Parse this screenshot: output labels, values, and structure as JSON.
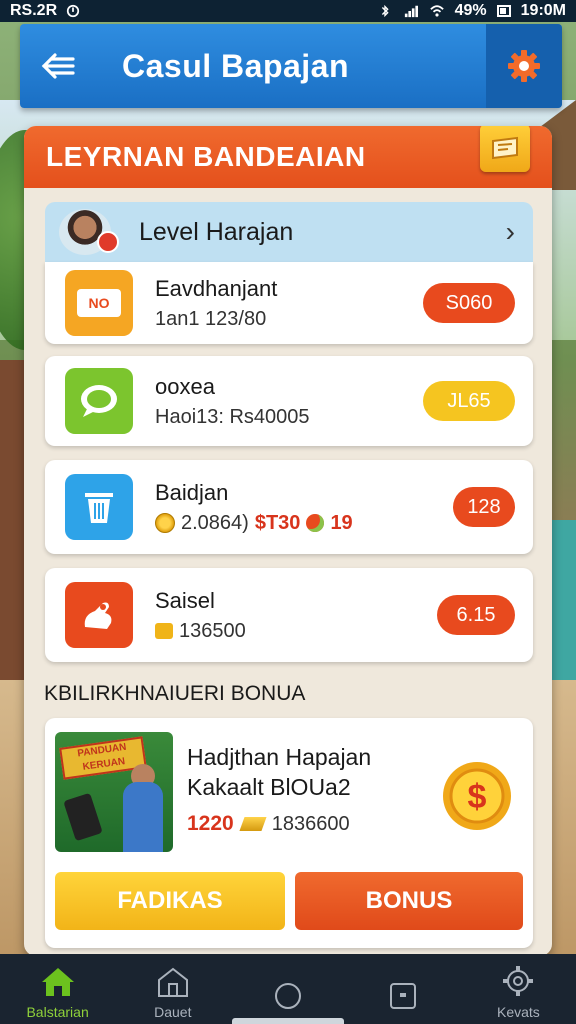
{
  "status_bar": {
    "left_text": "RS.2R",
    "battery": "49%",
    "time": "19:0M"
  },
  "header": {
    "title": "Casul Bapajan",
    "back_icon": "back-arrow-icon",
    "settings_icon": "gear-icon"
  },
  "panel": {
    "banner_title": "LEYRNAN BANDEAIAN"
  },
  "level": {
    "label": "Level Harajan"
  },
  "rewards": [
    {
      "title": "Eavdhanjant",
      "sub": "1an1 123/80",
      "pill": "S060",
      "icon": "ticket-icon",
      "icon_label": "NO",
      "icon_color": "#f5a623",
      "pill_color": "#e84a1e"
    },
    {
      "title": "ooxea",
      "sub": "Haoi13: Rs40005",
      "pill": "JL65",
      "icon": "chat-icon",
      "icon_color": "#7cc52e",
      "pill_color": "#f5c520"
    },
    {
      "title": "Baidjan",
      "sub_coin": "2.0864)",
      "sub_amount": "$T30",
      "sub_extra": "19",
      "pill": "128",
      "icon": "trash-icon",
      "icon_color": "#2ea3e8",
      "pill_color": "#e84a1e"
    },
    {
      "title": "Saisel",
      "sub": "136500",
      "pill": "6.15",
      "icon": "hand-icon",
      "icon_color": "#e84a1e",
      "pill_color": "#e84a1e"
    }
  ],
  "bonus": {
    "heading": "KBILIRKHNAIUERI BONUA",
    "promo_text": "PANDUAN KERUAN",
    "title_line1": "Hadjthan Hapajan",
    "title_line2": "Kakaalt BlOUa2",
    "amount": "1220",
    "extra": "1836600",
    "btn_left": "FADIKAS",
    "btn_right": "BONUS"
  },
  "nav": [
    {
      "label": "Balstarian",
      "icon": "home-icon",
      "active": true
    },
    {
      "label": "Dauet",
      "icon": "building-icon",
      "active": false
    },
    {
      "label": "",
      "icon": "circle-icon",
      "active": false
    },
    {
      "label": "",
      "icon": "square-icon",
      "active": false
    },
    {
      "label": "Kevats",
      "icon": "gear-icon",
      "active": false
    }
  ],
  "colors": {
    "accent_orange": "#e84a1e",
    "header_blue": "#1a6fc4",
    "yellow": "#f5c520"
  }
}
